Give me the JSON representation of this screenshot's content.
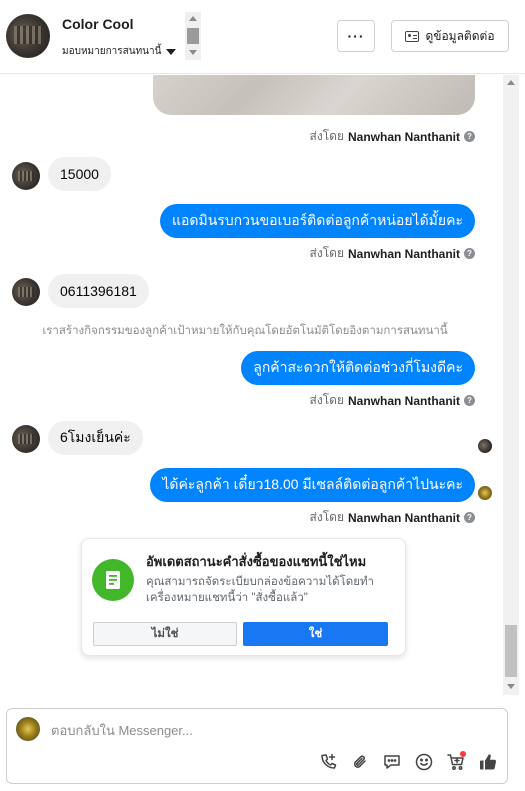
{
  "header": {
    "page_name": "Color Cool",
    "assign_label": "มอบหมายการสนทนานี้",
    "more_label": "···",
    "contact_label": "ดูข้อมูลติดต่อ"
  },
  "messages": {
    "sent_prefix": "ส่งโดย",
    "sender": "Nanwhan Nanthanit",
    "info_glyph": "?",
    "m1": "15000",
    "m2": "แอดมินรบกวนขอเบอร์ติดต่อลูกค้าหน่อยได้มั้ยคะ",
    "m3": "0611396181",
    "system_note": "เราสร้างกิจกรรมของลูกค้าเป้าหมายให้กับคุณโดยอัตโนมัติโดยอิงตามการสนทนานี้",
    "m4": "ลูกค้าสะดวกให้ติดต่อช่วงกี่โมงดีคะ",
    "m5": "6โมงเย็นค่ะ",
    "m6": "ได้ค่ะลูกค้า เดี๋ยว18.00 มีเซลล์ติดต่อลูกค้าไปนะคะ"
  },
  "order_card": {
    "title": "อัพเดตสถานะคำสั่งซื้อของแชทนี้ใช่ไหม",
    "description": "คุณสามารถจัดระเบียบกล่องข้อความได้โดยทำเครื่องหมายแชทนี้ว่า \"สั่งซื้อแล้ว\"",
    "no_label": "ไม่ใช่",
    "yes_label": "ใช่"
  },
  "composer": {
    "placeholder": "ตอบกลับใน Messenger..."
  },
  "colors": {
    "accent": "#0084ff",
    "primary_button": "#1877f2",
    "success": "#42b72a",
    "notification": "#fa383e"
  },
  "icons": [
    "chevron-down-icon",
    "more-icon",
    "contact-card-icon",
    "info-icon",
    "order-list-icon",
    "call-add-icon",
    "attach-icon",
    "saved-reply-icon",
    "emoji-icon",
    "cart-icon",
    "like-icon"
  ]
}
